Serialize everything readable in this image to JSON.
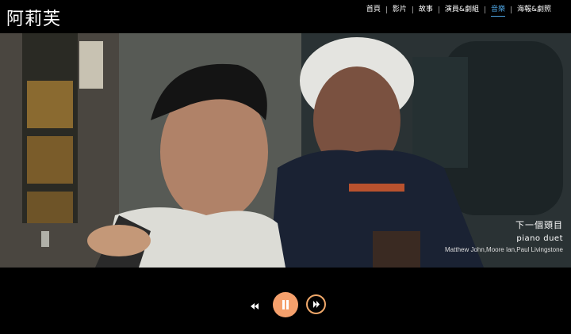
{
  "site": {
    "title": "阿莉芙"
  },
  "nav": {
    "items": [
      {
        "label": "首頁"
      },
      {
        "label": "影片"
      },
      {
        "label": "故事"
      },
      {
        "label": "演員&劇組"
      },
      {
        "label": "音樂",
        "active": true
      },
      {
        "label": "海報&劇照"
      }
    ]
  },
  "player": {
    "next_label": "下一個頭目",
    "track_title": "piano duet",
    "track_artists": "Matthew John,Moore Ian,Paul Livingstone",
    "buttons": {
      "prev_icon": "rewind-icon",
      "pause_icon": "pause-icon",
      "next_icon": "fast-forward-icon"
    }
  },
  "colors": {
    "accent": "#f5a06c",
    "nav_active": "#4da3e0",
    "background": "#000000"
  }
}
